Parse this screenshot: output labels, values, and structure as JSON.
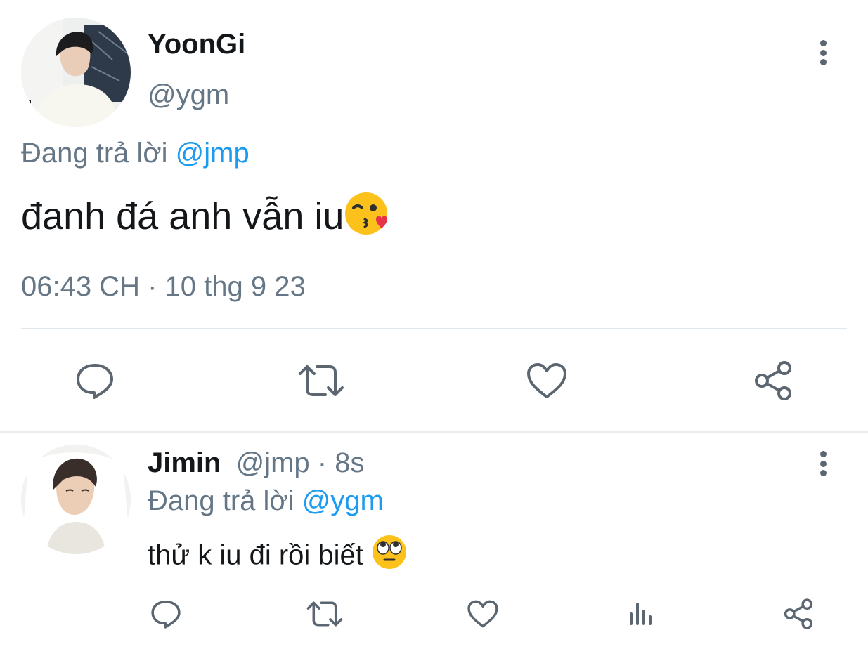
{
  "main_tweet": {
    "author_name": "YoonGi",
    "handle": "@ygm",
    "reply_prefix": "Đang trả lời",
    "reply_to": "@jmp",
    "text": "đanh đá anh vẫn iu",
    "emoji": "kissing-face-with-heart",
    "timestamp": "06:43 CH · 10 thg 9 23",
    "actions": [
      "reply",
      "retweet",
      "like",
      "share"
    ]
  },
  "reply_tweet": {
    "author_name": "Jimin",
    "handle": "@jmp",
    "age": "· 8s",
    "reply_prefix": "Đang trả lời",
    "reply_to": "@ygm",
    "text": "thử k iu đi rồi biết",
    "emoji": "face-with-rolling-eyes",
    "actions": [
      "reply",
      "retweet",
      "like",
      "analytics",
      "share"
    ]
  },
  "colors": {
    "text": "#14171a",
    "muted": "#657786",
    "link": "#1d9bf0",
    "icon": "#5b6670",
    "divider": "#e1e8ed"
  }
}
